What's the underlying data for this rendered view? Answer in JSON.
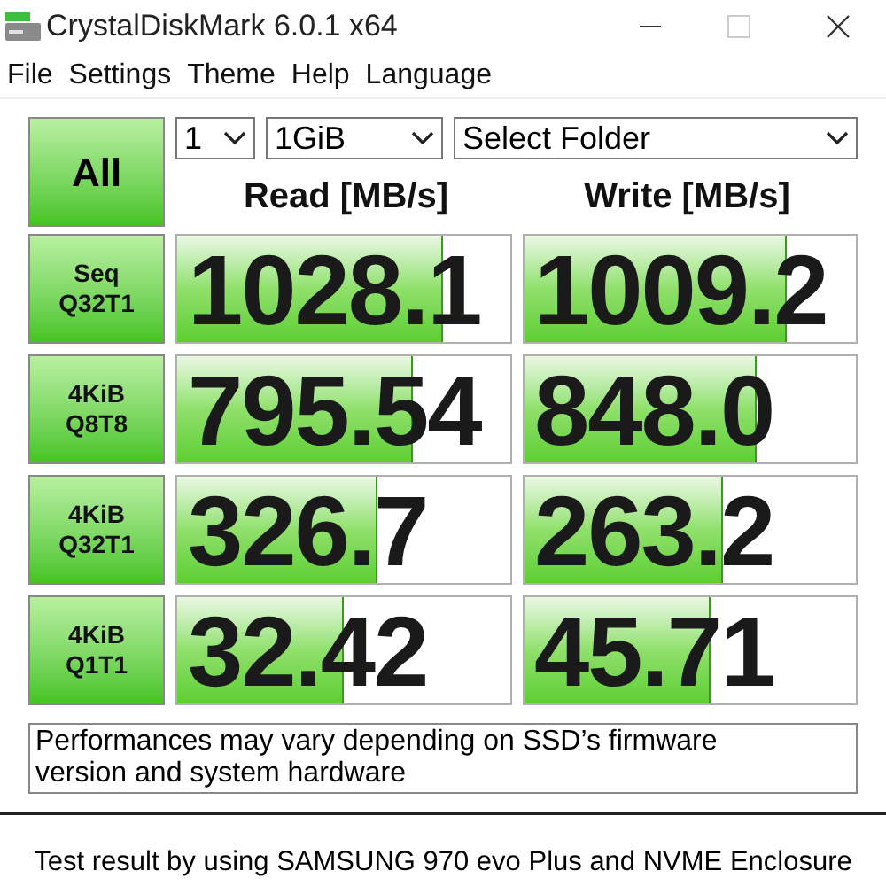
{
  "window": {
    "title": "CrystalDiskMark 6.0.1 x64"
  },
  "menu": [
    "File",
    "Settings",
    "Theme",
    "Help",
    "Language"
  ],
  "all_button": "All",
  "selects": [
    {
      "value": "1"
    },
    {
      "value": "1GiB"
    },
    {
      "value": "Select Folder"
    }
  ],
  "headers": [
    "Read [MB/s]",
    "Write [MB/s]"
  ],
  "rows": [
    {
      "line1": "Seq",
      "line2": "Q32T1",
      "read": {
        "value": "1028.1",
        "level": 0.8
      },
      "write": {
        "value": "1009.2",
        "level": 0.79
      }
    },
    {
      "line1": "4KiB",
      "line2": "Q8T8",
      "read": {
        "value": "795.54",
        "level": 0.71
      },
      "write": {
        "value": "848.0",
        "level": 0.7
      }
    },
    {
      "line1": "4KiB",
      "line2": "Q32T1",
      "read": {
        "value": "326.7",
        "level": 0.6
      },
      "write": {
        "value": "263.2",
        "level": 0.6
      }
    },
    {
      "line1": "4KiB",
      "line2": "Q1T1",
      "read": {
        "value": "32.42",
        "level": 0.5
      },
      "write": {
        "value": "45.71",
        "level": 0.56
      }
    }
  ],
  "comment": "Performances may vary depending on SSD’s firmware version and system hardware",
  "caption": "Test result by using SAMSUNG 970 evo Plus and NVME Enclosure"
}
